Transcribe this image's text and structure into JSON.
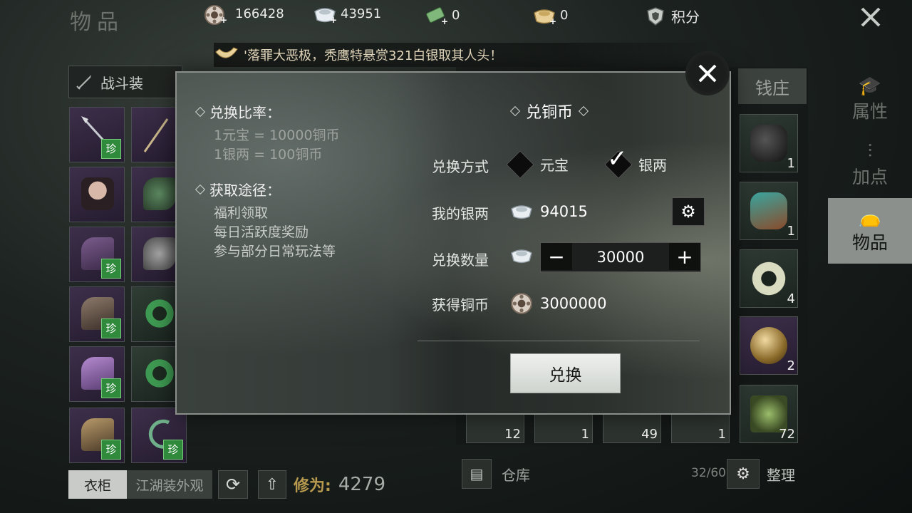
{
  "page": {
    "title": "物品"
  },
  "currencies": [
    {
      "name": "copper-coin",
      "value": "166428",
      "color": "#d8cfc4"
    },
    {
      "name": "silver-tael",
      "value": "43951",
      "color": "#e8eef2"
    },
    {
      "name": "jade-ticket",
      "value": "0",
      "color": "#7fb87a"
    },
    {
      "name": "gold-ingot",
      "value": "0",
      "color": "#e2c993"
    }
  ],
  "points": {
    "label": "积分"
  },
  "announcement": {
    "text": "'落罪大恶极，秃鹰特悬赏321白银取其人头！"
  },
  "left_panel": {
    "outfit_label": "战斗装",
    "wardrobe_tab": "衣柜",
    "appearance_tab": "江湖装外观",
    "cultivation_label": "修为:",
    "cultivation_value": "4279",
    "rare_tag": "珍"
  },
  "right_panel": {
    "bank_tab": "钱庄",
    "item_counts": [
      "1",
      "1",
      "4",
      "2",
      "72"
    ],
    "bottom_counts": [
      "12",
      "1",
      "49",
      "1"
    ],
    "storage_label": "仓库",
    "capacity": "32/60",
    "sort_label": "整理"
  },
  "right_nav": [
    {
      "label": "属性",
      "active": false
    },
    {
      "label": "加点",
      "active": false
    },
    {
      "label": "物品",
      "active": true
    }
  ],
  "modal": {
    "rate_title": "兑换比率：",
    "rate_lines": [
      "1元宝 = 10000铜币",
      "1银两 = 100铜币"
    ],
    "source_title": "获取途径：",
    "source_lines": [
      "福利领取",
      "每日活跃度奖励",
      "参与部分日常玩法等"
    ],
    "exchange_title": "兑铜币",
    "method_label": "兑换方式",
    "option_ingot": "元宝",
    "option_silver": "银两",
    "my_silver_label": "我的银两",
    "my_silver_value": "94015",
    "qty_label": "兑换数量",
    "qty_value": "30000",
    "result_label": "获得铜币",
    "result_value": "3000000",
    "confirm_label": "兑换"
  }
}
